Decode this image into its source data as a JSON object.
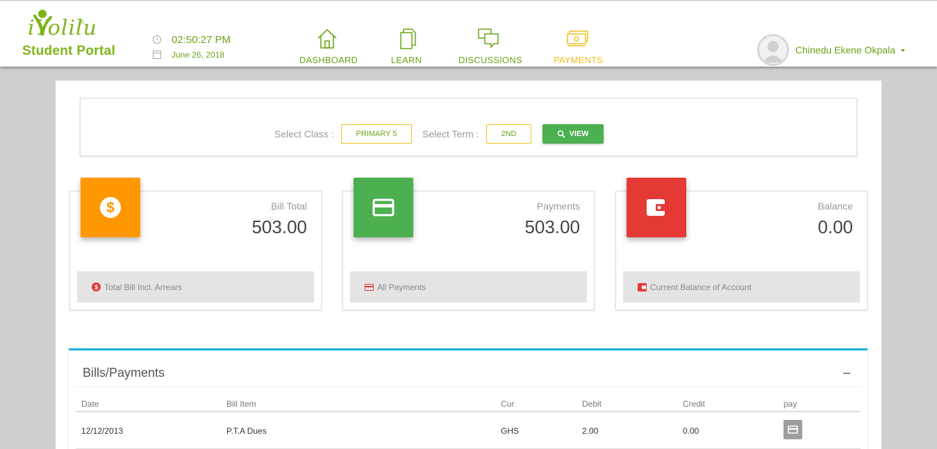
{
  "header": {
    "logo_word": "iYolilu",
    "logo_reg": "®",
    "logo_sub": "Student Portal",
    "time": "02:50:27 PM",
    "date": "June 26, 2018",
    "nav": [
      {
        "label": "DASHBOARD",
        "icon": "home-icon"
      },
      {
        "label": "LEARN",
        "icon": "documents-icon"
      },
      {
        "label": "DISCUSSIONS",
        "icon": "chat-icon"
      },
      {
        "label": "PAYMENTS",
        "icon": "money-icon",
        "active": true
      }
    ],
    "user_name": "Chinedu Ekene Okpala"
  },
  "filter": {
    "class_label": "Select Class :",
    "class_value": "PRIMARY 5",
    "term_label": "Select Term :",
    "term_value": "2ND",
    "view_label": "VIEW"
  },
  "cards": [
    {
      "title": "Bill Total",
      "value": "503.00",
      "footer": "Total Bill Incl. Arrears",
      "color": "#ff9800",
      "icon": "dollar-icon"
    },
    {
      "title": "Payments",
      "value": "503.00",
      "footer": "All Payments",
      "color": "#4caf50",
      "icon": "credit-card-icon"
    },
    {
      "title": "Balance",
      "value": "0.00",
      "footer": "Current Balance of Account",
      "color": "#e53935",
      "icon": "wallet-icon"
    }
  ],
  "bills": {
    "title": "Bills/Payments",
    "columns": [
      "Date",
      "Bill Item",
      "Cur",
      "Debit",
      "Credit",
      "pay"
    ],
    "rows": [
      {
        "date": "12/12/2013",
        "item": "P.T.A Dues",
        "cur": "GHS",
        "debit": "2.00",
        "credit": "0.00"
      }
    ]
  },
  "colors": {
    "brand_green": "#6aa318",
    "active_yellow": "#f0c01e",
    "accent_blue": "#1ab0e0"
  }
}
